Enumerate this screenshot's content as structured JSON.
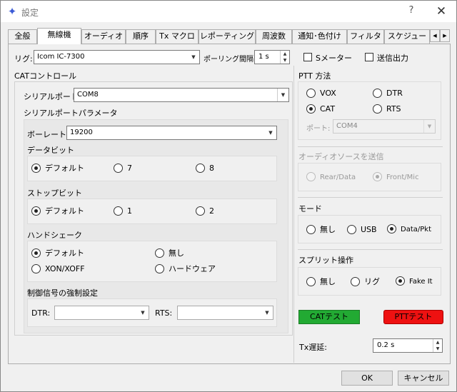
{
  "window": {
    "title": "設定",
    "help": "?",
    "close": "✕"
  },
  "tabs": [
    {
      "label": "全般"
    },
    {
      "label": "無線機"
    },
    {
      "label": "オーディオ"
    },
    {
      "label": "順序"
    },
    {
      "label": "Tx マクロ"
    },
    {
      "label": "レポーティング"
    },
    {
      "label": "周波数"
    },
    {
      "label": "通知･色付け"
    },
    {
      "label": "フィルタ"
    },
    {
      "label": "スケジュー"
    }
  ],
  "rig": {
    "label": "リグ:",
    "value": "Icom IC-7300"
  },
  "polling": {
    "label": "ポーリング間隔:",
    "value": "1 s"
  },
  "s_meter": {
    "label": "Sメーター",
    "checked": false
  },
  "tx_power": {
    "label": "送信出力",
    "checked": false
  },
  "cat": {
    "title": "CATコントロール",
    "serial_port_label": "シリアルポート:",
    "serial_port_value": "COM8",
    "params_title": "シリアルポートパラメータ",
    "baud_label": "ボーレート:",
    "baud_value": "19200",
    "databits": {
      "title": "データビット",
      "opt_default": "デフォルト",
      "opt_7": "7",
      "opt_8": "8",
      "selected": "default"
    },
    "stopbits": {
      "title": "ストップビット",
      "opt_default": "デフォルト",
      "opt_1": "1",
      "opt_2": "2",
      "selected": "default"
    },
    "handshake": {
      "title": "ハンドシェーク",
      "opt_default": "デフォルト",
      "opt_none": "無し",
      "opt_xon": "XON/XOFF",
      "opt_hw": "ハードウェア",
      "selected": "default"
    },
    "force": {
      "title": "制御信号の強制設定",
      "dtr_label": "DTR:",
      "dtr_value": "",
      "rts_label": "RTS:",
      "rts_value": ""
    }
  },
  "ptt": {
    "title": "PTT 方法",
    "opt_vox": "VOX",
    "opt_dtr": "DTR",
    "opt_cat": "CAT",
    "opt_rts": "RTS",
    "selected": "CAT",
    "port_label": "ポート:",
    "port_value": "COM4"
  },
  "audio_source": {
    "title": "オーディオソースを送信",
    "opt_rear": "Rear/Data",
    "opt_front": "Front/Mic",
    "selected": "front"
  },
  "mode": {
    "title": "モード",
    "opt_none": "無し",
    "opt_usb": "USB",
    "opt_data": "Data/Pkt",
    "selected": "data"
  },
  "split": {
    "title": "スプリット操作",
    "opt_none": "無し",
    "opt_rig": "リグ",
    "opt_fake": "Fake It",
    "selected": "fake"
  },
  "test": {
    "cat_label": "CATテスト",
    "ptt_label": "PTTテスト",
    "cat_color": "#22aa33",
    "ptt_color": "#ee1111"
  },
  "tx_delay": {
    "label": "Tx遅延:",
    "value": "0.2 s"
  },
  "footer": {
    "ok_label": "OK",
    "cancel_label": "キャンセル"
  }
}
